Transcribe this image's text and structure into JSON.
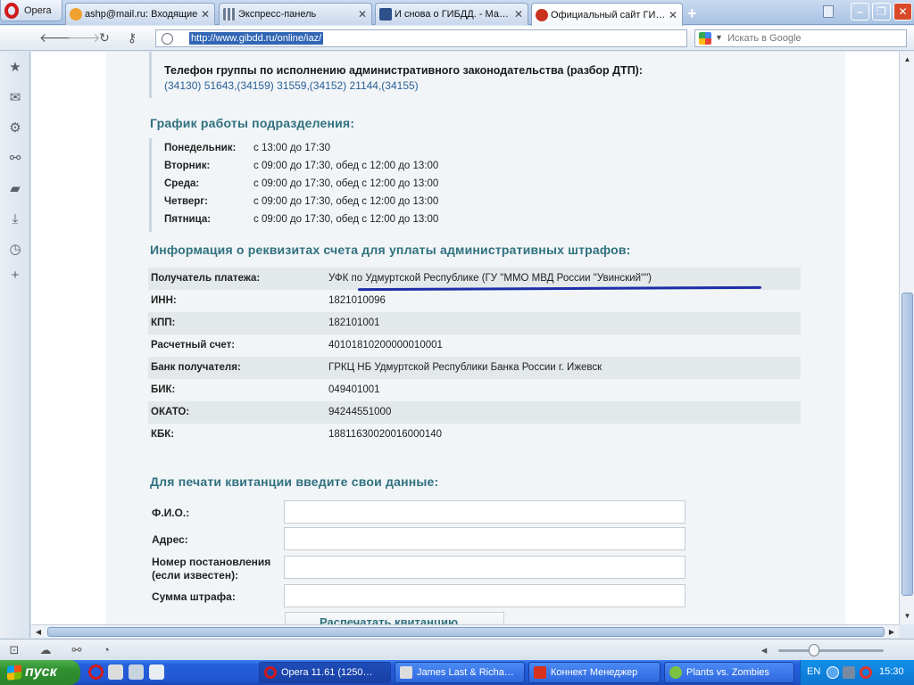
{
  "browser": {
    "menu_label": "Opera",
    "tabs": [
      {
        "label": "ashp@mail.ru: Входящие",
        "icon": "mail-ru-icon",
        "active": false
      },
      {
        "label": "Экспресс-панель",
        "icon": "speed-dial-icon",
        "active": false
      },
      {
        "label": "И снова о ГИБДД. - Мар…",
        "icon": "blog-icon",
        "active": false
      },
      {
        "label": "Официальный сайт ГИБ…",
        "icon": "gibdd-icon",
        "active": true
      }
    ],
    "address_url": "http://www.gibdd.ru/online/iaz/",
    "search_placeholder": "Искать в Google"
  },
  "page": {
    "phone": {
      "title": "Телефон группы по исполнению административного законодательства (разбор ДТП):",
      "values": "(34130) 51643,(34159) 31559,(34152) 21144,(34155)"
    },
    "schedule": {
      "heading": "График работы подразделения:",
      "rows": [
        {
          "day": "Понедельник:",
          "hours": "с 13:00 до 17:30"
        },
        {
          "day": "Вторник:",
          "hours": "с 09:00 до 17:30, обед с 12:00 до 13:00"
        },
        {
          "day": "Среда:",
          "hours": "с 09:00 до 17:30, обед с 12:00 до 13:00"
        },
        {
          "day": "Четверг:",
          "hours": "с 09:00 до 17:30, обед с 12:00 до 13:00"
        },
        {
          "day": "Пятница:",
          "hours": "с 09:00 до 17:30, обед с 12:00 до 13:00"
        }
      ]
    },
    "requisites": {
      "heading": "Информация о реквизитах счета для уплаты административных штрафов:",
      "rows": [
        {
          "label": "Получатель платежа:",
          "value": "УФК по Удмуртской Республике (ГУ \"ММО МВД России \"Увинский\"\")"
        },
        {
          "label": "ИНН:",
          "value": "1821010096"
        },
        {
          "label": "КПП:",
          "value": "182101001"
        },
        {
          "label": "Расчетный счет:",
          "value": "40101810200000010001"
        },
        {
          "label": "Банк получателя:",
          "value": "ГРКЦ НБ Удмуртской Республики Банка России г. Ижевск"
        },
        {
          "label": "БИК:",
          "value": "049401001"
        },
        {
          "label": "ОКАТО:",
          "value": "94244551000"
        },
        {
          "label": "КБК:",
          "value": "18811630020016000140"
        }
      ]
    },
    "form": {
      "heading": "Для печати квитанции введите свои данные:",
      "fio_label": "Ф.И.О.:",
      "address_label": "Адрес:",
      "decree_label_line1": "Номер постановления",
      "decree_label_line2": "(если известен):",
      "amount_label": "Сумма штрафа:",
      "print_button": "Распечатать квитанцию"
    }
  },
  "taskbar": {
    "start_label": "пуск",
    "tasks": [
      {
        "label": "Opera 11.61 (1250…",
        "active": true
      },
      {
        "label": "James Last & Richa…",
        "active": false
      },
      {
        "label": "Коннект Менеджер",
        "active": false
      },
      {
        "label": "Plants vs. Zombies",
        "active": false
      }
    ],
    "language": "EN",
    "clock": "15:30"
  },
  "colors": {
    "heading_teal": "#30707f",
    "phone_blue": "#2a5f96",
    "underline_mark": "#1c2fa8",
    "taskbar_blue": "#245edb",
    "start_green": "#2f8f2f"
  }
}
